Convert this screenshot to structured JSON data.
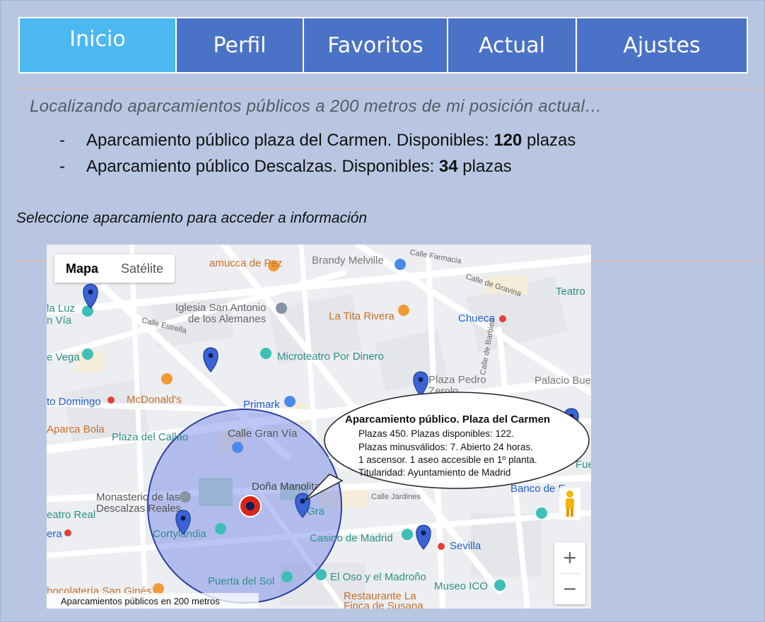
{
  "nav": {
    "tabs": [
      {
        "label": "Inicio",
        "active": true
      },
      {
        "label": "Perfil",
        "active": false
      },
      {
        "label": "Favoritos",
        "active": false
      },
      {
        "label": "Actual",
        "active": false
      },
      {
        "label": "Ajustes",
        "active": false
      }
    ]
  },
  "info": {
    "searching_text": "Localizando aparcamientos públicos a 200 metros de mi posición actual…",
    "results": [
      {
        "dash": "-",
        "text": "Aparcamiento público plaza del Carmen. Disponibles: ",
        "count": "120",
        "unit": " plazas"
      },
      {
        "dash": "-",
        "text": "Aparcamiento público Descalzas. Disponibles: ",
        "count": "34",
        "unit": " plazas"
      }
    ],
    "prompt": "Seleccione aparcamiento para acceder a información"
  },
  "map": {
    "type_buttons": {
      "map": "Mapa",
      "satellite": "Satélite"
    },
    "zoom_in": "+",
    "zoom_out": "−",
    "caption": "Aparcamientos públicos en 200 metros",
    "labels": {
      "ramucca": "amucca de Pez",
      "brandy": "Brandy Melville",
      "calle_farmacia": "Calle Farmacia",
      "iglesia_1": "Iglesia San Antonio",
      "iglesia_2": "de los Alemanes",
      "la_luz": "la Luz",
      "gran_via_w": "n Vía",
      "calle_estrella": "Calle Estrella",
      "tita": "La Tita Rivera",
      "chueca": "Chueca",
      "calle_gravina": "Calle de Gravina",
      "teatro": "Teatro",
      "vega": "e Vega",
      "microteatro": "Microteatro Por Dinero",
      "plaza_pedro": "Plaza Pedro",
      "zerolo": "Zerolo",
      "barbieri": "Calle de Barbieri",
      "palacio": "Palacio Buenav",
      "domingo": "to Domingo",
      "mcdonalds": "McDonald's",
      "primark": "Primark",
      "bola": "Aparca Bola",
      "callao": "Plaza del Callao",
      "calle_gran_via": "Calle Gran Vía",
      "dona_manolita": "Doña Manolita",
      "monasterio_1": "Monasterio de las",
      "monasterio_2": "Descalzas Reales",
      "teatro_real": "eatro Real",
      "opera": "era",
      "cortylandia": "Cortylandia",
      "calle_jardines": "Calle Jardines",
      "banco": "Banco de E",
      "fue": "Fue",
      "casino": "Casino de Madrid",
      "sevilla": "Sevilla",
      "puerta_sol": "Puerta del Sol",
      "oso": "El Oso y el Madroño",
      "museo": "Museo ICO",
      "chocolateria": "hocolatería San Ginés",
      "restaurante_1": "Restaurante La",
      "restaurante_2": "Finca de Susana",
      "gra": "Gra"
    },
    "colors": {
      "radius_fill": "#6b7fe6",
      "radius_stroke": "#2c3fa0",
      "marker": "#3b63d6",
      "position": "#d8261b"
    }
  },
  "popup": {
    "title": "Aparcamiento público. Plaza del Carmen",
    "lines": [
      "Plazas 450. Plazas disponibles: 122.",
      "Plazas minusválidos: 7. Abierto 24 horas.",
      "1 ascensor. 1 aseo accesible en 1º planta.",
      "Titularidad: Ayuntamiento de Madrid"
    ]
  }
}
